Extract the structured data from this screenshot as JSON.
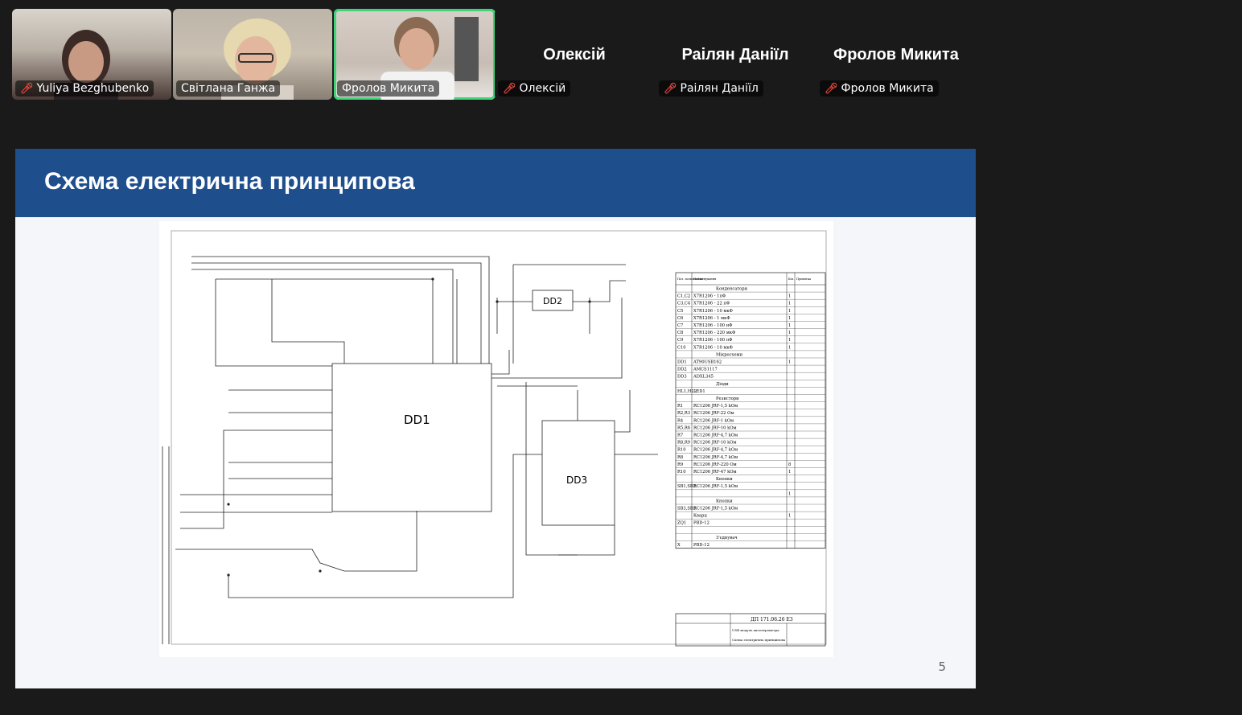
{
  "participants": [
    {
      "name": "Yuliya Bezghubenko",
      "type": "video",
      "muted": true
    },
    {
      "name": "Світлана Ганжа",
      "type": "video",
      "muted": false
    },
    {
      "name": "Фролов Микита",
      "type": "video",
      "muted": false,
      "active": true
    },
    {
      "name": "Олексій",
      "type": "avatar",
      "muted": true
    },
    {
      "name": "Раілян Даніїл",
      "type": "avatar",
      "muted": true
    },
    {
      "name": "Фролов Микита",
      "type": "avatar",
      "muted": true
    }
  ],
  "slide": {
    "title": "Схема електрична принципова",
    "page_number": "5",
    "header_color": "#1f4e8c"
  },
  "schematic": {
    "chips": [
      "DD1",
      "DD2",
      "DD3"
    ],
    "parts_table": {
      "headers": [
        "Поз. позначення",
        "Найменування",
        "Кіл.",
        "Примітка"
      ],
      "rows": [
        [
          "",
          "Конденсатори",
          "",
          ""
        ],
        [
          "C1,C2",
          "X7R1206 - 1пФ",
          "1",
          ""
        ],
        [
          "C3,C4",
          "X7R1206 - 22 пФ",
          "1",
          ""
        ],
        [
          "C5",
          "X7R1206 - 10 мкФ",
          "1",
          ""
        ],
        [
          "C6",
          "X7R1206 - 1 мкФ",
          "1",
          ""
        ],
        [
          "C7",
          "X7R1206 - 100 нФ",
          "1",
          ""
        ],
        [
          "C8",
          "X7R1206 - 220 мкФ",
          "1",
          ""
        ],
        [
          "C9",
          "X7R1206 - 100 пФ",
          "1",
          ""
        ],
        [
          "C10",
          "X7R1206 - 10 мкФ",
          "1",
          ""
        ],
        [
          "",
          "Мікросхеми",
          "",
          ""
        ],
        [
          "DD1",
          "AT90USB162",
          "1",
          ""
        ],
        [
          "DD2",
          "AMCS1117",
          "",
          ""
        ],
        [
          "DD3",
          "ADXL345",
          "",
          ""
        ],
        [
          "",
          "Діоди",
          "",
          ""
        ],
        [
          "HL1,HL2",
          "LED1",
          "",
          ""
        ],
        [
          "",
          "Резистори",
          "",
          ""
        ],
        [
          "R1",
          "RC1206 JRF-1,5 kOм",
          "",
          ""
        ],
        [
          "R2,R3",
          "RC1206 JRF-22 Ом",
          "",
          ""
        ],
        [
          "R4",
          "RC1206 JRF-1 kOм",
          "",
          ""
        ],
        [
          "R5,R6",
          "RC1206 JRF-10 kOм",
          "",
          ""
        ],
        [
          "R7",
          "RC1206 JRF-4,7 kOм",
          "",
          ""
        ],
        [
          "R8,R9",
          "RC1206 JRF-10 kOм",
          "",
          ""
        ],
        [
          "R10",
          "RC1206 JRF-4,7 kOм",
          "",
          ""
        ],
        [
          "R8",
          "RC1206 JRF-4,7 kOм",
          "",
          ""
        ],
        [
          "R9",
          "RC1206 JRF-220 Ом",
          "8",
          ""
        ],
        [
          "R10",
          "RC1206 JRF-47 kOм",
          "1",
          ""
        ],
        [
          "",
          "Кнопки",
          "",
          ""
        ],
        [
          "SB1,SB2",
          "RC1206 JRF-1,5 kOм",
          "",
          ""
        ],
        [
          "",
          "",
          "1",
          ""
        ],
        [
          "",
          "Кнопки",
          "",
          ""
        ],
        [
          "SB3,SB2",
          "RC1206 JRF-1,5 kOм",
          "",
          ""
        ],
        [
          "",
          "Кварц",
          "1",
          ""
        ],
        [
          "ZQ1",
          "PBD-12",
          "",
          ""
        ],
        [
          "",
          "",
          "",
          ""
        ],
        [
          "",
          "З'єднувач",
          "",
          ""
        ],
        [
          "X",
          "PBD-12",
          "",
          ""
        ]
      ]
    },
    "title_block": {
      "doc_code": "ДП 171.06.26 Е3",
      "product": "USB модуль акселерометра",
      "doc_name": "Схема електрична принципова"
    }
  }
}
